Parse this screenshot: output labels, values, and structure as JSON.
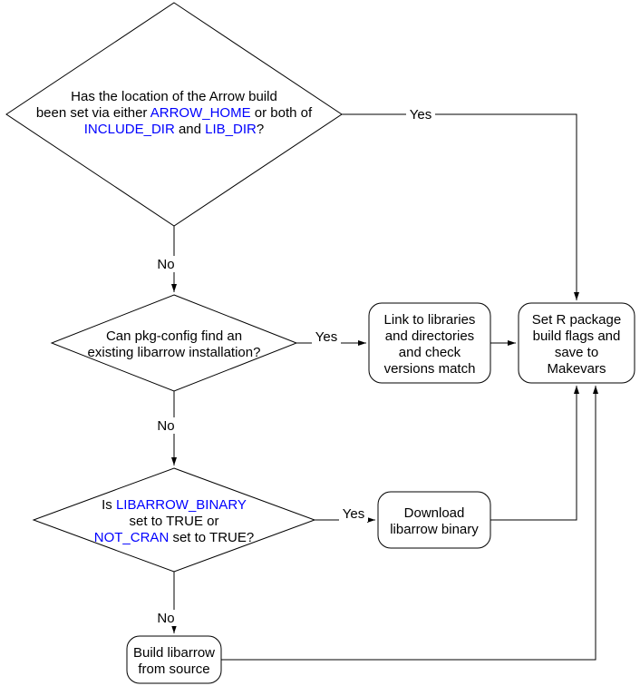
{
  "chart_data": {
    "type": "flowchart",
    "nodes": [
      {
        "id": "q1",
        "type": "decision",
        "lines": [
          {
            "text": "Has the location of the Arrow build"
          },
          {
            "text": "been set via either "
          },
          {
            "text": " or both of"
          },
          {
            "text": " and "
          }
        ],
        "vars": {
          "v1": "ARROW_HOME",
          "v2": "INCLUDE_DIR",
          "v3": "LIB_DIR"
        }
      },
      {
        "id": "q2",
        "type": "decision",
        "line1": "Can pkg-config find an",
        "line2": "existing libarrow installation?"
      },
      {
        "id": "q3",
        "type": "decision",
        "pre": "Is ",
        "v1": "LIBARROW_BINARY",
        "line2": "set to TRUE or",
        "v2": "NOT_CRAN",
        "post": " set to TRUE?"
      },
      {
        "id": "p1",
        "type": "process",
        "l1": "Link to libraries",
        "l2": "and directories",
        "l3": "and check",
        "l4": "versions match"
      },
      {
        "id": "p2",
        "type": "process",
        "l1": "Download",
        "l2": "libarrow binary"
      },
      {
        "id": "p3",
        "type": "process",
        "l1": "Build libarrow",
        "l2": "from source"
      },
      {
        "id": "end",
        "type": "process",
        "l1": "Set R package",
        "l2": "build flags and",
        "l3": "save to",
        "l4": "Makevars"
      }
    ],
    "edges": {
      "yes": "Yes",
      "no": "No"
    }
  }
}
